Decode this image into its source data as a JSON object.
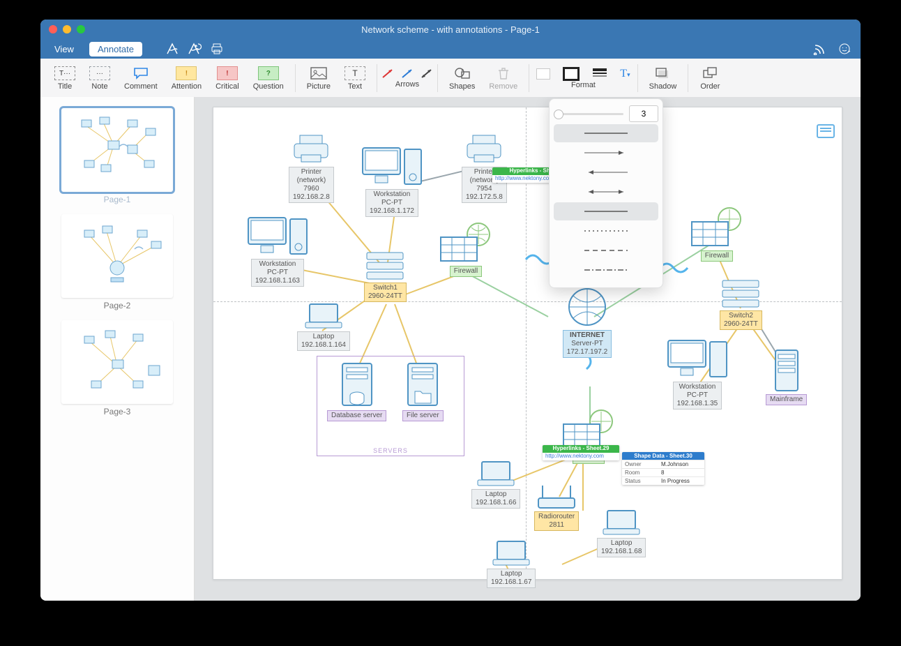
{
  "window": {
    "title": "Network scheme - with annotations - Page-1"
  },
  "tabs": {
    "view": "View",
    "annotate": "Annotate"
  },
  "toolbar": {
    "title": "Title",
    "note": "Note",
    "comment": "Comment",
    "attention": "Attention",
    "critical": "Critical",
    "question": "Question",
    "picture": "Picture",
    "text": "Text",
    "arrows": "Arrows",
    "shapes": "Shapes",
    "remove": "Remove",
    "format": "Format",
    "shadow": "Shadow",
    "order": "Order"
  },
  "popover": {
    "value": "3"
  },
  "sidebar": {
    "pages": [
      "Page-1",
      "Page-2",
      "Page-3"
    ]
  },
  "nodes": {
    "printer1": {
      "name": "Printer",
      "sub": "(network)",
      "model": "7960",
      "ip": "192.168.2.8"
    },
    "printer2": {
      "name": "Printer",
      "sub": "(network)",
      "model": "7954",
      "ip": "192.172.5.8"
    },
    "workstation1": {
      "name": "Workstation",
      "sub": "PC-PT",
      "ip": "192.168.1.172"
    },
    "workstation2": {
      "name": "Workstation",
      "sub": "PC-PT",
      "ip": "192.168.1.163"
    },
    "workstation3": {
      "name": "Workstation",
      "sub": "PC-PT",
      "ip": "192.168.1.35"
    },
    "laptop1": {
      "name": "Laptop",
      "ip": "192.168.1.164"
    },
    "laptop2": {
      "name": "Laptop",
      "ip": "192.168.1.66"
    },
    "laptop3": {
      "name": "Laptop",
      "ip": "192.168.1.67"
    },
    "laptop4": {
      "name": "Laptop",
      "ip": "192.168.1.68"
    },
    "switch1": {
      "name": "Switch1",
      "model": "2960-24TT"
    },
    "switch2": {
      "name": "Switch2",
      "model": "2960-24TT"
    },
    "firewall1": {
      "name": "Firewall"
    },
    "firewall2": {
      "name": "Firewall"
    },
    "firewall3": {
      "name": "Firewall"
    },
    "internet": {
      "name": "INTERNET",
      "sub": "Server-PT",
      "ip": "172.17.197.2"
    },
    "dbserver": {
      "name": "Database server"
    },
    "fileserver": {
      "name": "File server"
    },
    "mainframe": {
      "name": "Mainframe"
    },
    "radiorouter": {
      "name": "Radiorouter",
      "model": "2811"
    },
    "servers_group": "SERVERS"
  },
  "callouts": {
    "hl24": {
      "title": "Hyperlinks - Sheet.24",
      "url": "http://www.nektony.com"
    },
    "hl29": {
      "title": "Hyperlinks - Sheet.29",
      "url": "http://www.nektony.com"
    },
    "sd30": {
      "title": "Shape Data - Sheet.30",
      "rows": [
        [
          "Owner",
          "M.Johnson"
        ],
        [
          "Room",
          "8"
        ],
        [
          "Status",
          "In Progress"
        ]
      ]
    }
  }
}
